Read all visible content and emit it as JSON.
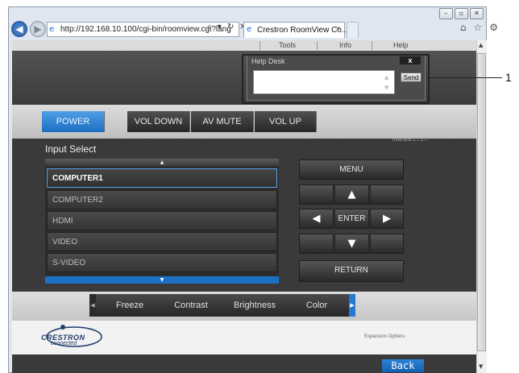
{
  "browser": {
    "url": "http://192.168.10.100/cgi-bin/roomview.cgi?lang",
    "address_controls": "⌕ ▾ ↻ ✕",
    "tab_title": "Crestron RoomView Co...",
    "tab_close": "×",
    "window_buttons": [
      "–",
      "▫",
      "✕"
    ],
    "toolbar_icons": [
      "⌂",
      "☆",
      "⚙"
    ]
  },
  "menu": {
    "tools": "Tools",
    "info": "Info",
    "help": "Help"
  },
  "helpdesk": {
    "title": "Help Desk",
    "close_label": "x",
    "send_label": "Send",
    "message": ""
  },
  "callout": {
    "number": "1"
  },
  "power_bar": {
    "power": "POWER",
    "vol_down": "VOL DOWN",
    "av_mute": "AV MUTE",
    "vol_up": "VOL UP"
  },
  "version": "Interface 2.7.2.7",
  "input_select": {
    "title": "Input Select",
    "items": [
      {
        "label": "COMPUTER1",
        "selected": true
      },
      {
        "label": "COMPUTER2",
        "selected": false
      },
      {
        "label": "HDMI",
        "selected": false
      },
      {
        "label": "VIDEO",
        "selected": false
      },
      {
        "label": "S-VIDEO",
        "selected": false
      }
    ]
  },
  "remote": {
    "menu": "MENU",
    "enter": "ENTER",
    "return": "RETURN"
  },
  "function_bar": {
    "freeze": "Freeze",
    "contrast": "Contrast",
    "brightness": "Brightness",
    "color": "Color"
  },
  "footer": {
    "logo_name": "CRESTRON",
    "logo_sub": "connected",
    "expansion": "Expansion Options",
    "back": "Back"
  },
  "colors": {
    "accent_blue": "#1d6ec2",
    "panel_dark": "#3a3a3a",
    "header_gray": "#dcdcdc"
  }
}
